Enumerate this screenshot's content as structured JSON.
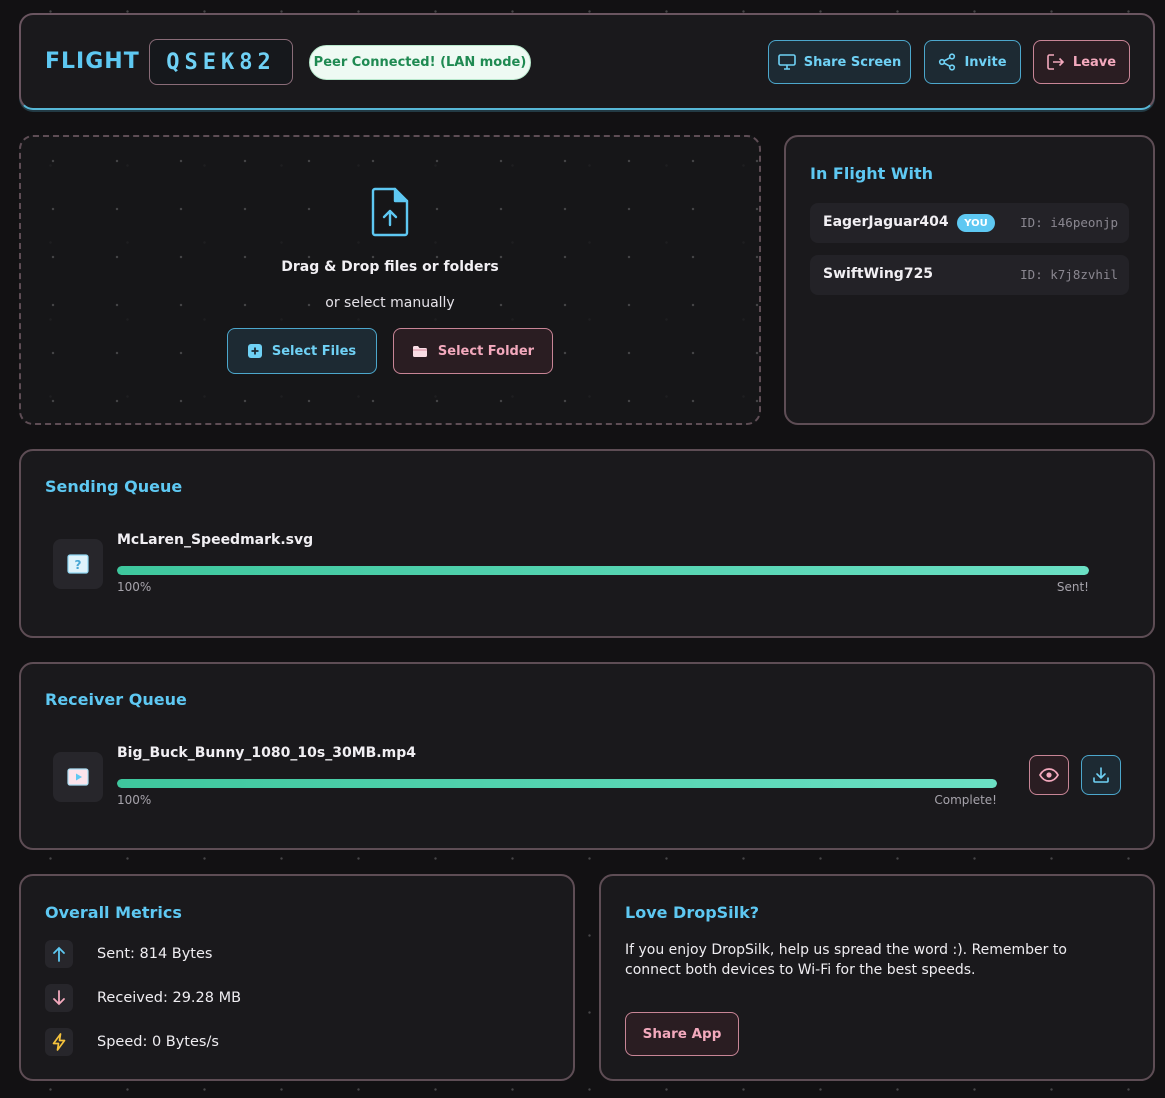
{
  "header": {
    "brand": "FLIGHT",
    "code": "QSEK82",
    "status": "Peer Connected! (LAN mode)",
    "buttons": {
      "share_screen": "Share Screen",
      "invite": "Invite",
      "leave": "Leave"
    }
  },
  "dropzone": {
    "title": "Drag & Drop files or folders",
    "subtitle": "or select manually",
    "select_files": "Select Files",
    "select_folder": "Select Folder"
  },
  "in_flight": {
    "title": "In Flight With",
    "peers": [
      {
        "name": "EagerJaguar404",
        "badge": "YOU",
        "id": "ID: i46peonjp"
      },
      {
        "name": "SwiftWing725",
        "id": "ID: k7j8zvhil"
      }
    ]
  },
  "sending_queue": {
    "title": "Sending Queue",
    "items": [
      {
        "name": "McLaren_Speedmark.svg",
        "progress": 100,
        "percent_label": "100%",
        "state": "Sent!"
      }
    ]
  },
  "receiver_queue": {
    "title": "Receiver Queue",
    "items": [
      {
        "name": "Big_Buck_Bunny_1080_10s_30MB.mp4",
        "progress": 100,
        "percent_label": "100%",
        "state": "Complete!"
      }
    ]
  },
  "metrics": {
    "title": "Overall Metrics",
    "sent": "Sent: 814 Bytes",
    "received": "Received: 29.28 MB",
    "speed": "Speed: 0 Bytes/s"
  },
  "love": {
    "title": "Love DropSilk?",
    "text": "If you enjoy DropSilk, help us spread the word :). Remember to connect both devices to Wi-Fi for the best speeds.",
    "button": "Share App"
  },
  "colors": {
    "accent_blue": "#5ec8f2",
    "accent_pink": "#f3a9bd",
    "progress_green": "#3ec79d",
    "status_green": "#1f8a52"
  }
}
